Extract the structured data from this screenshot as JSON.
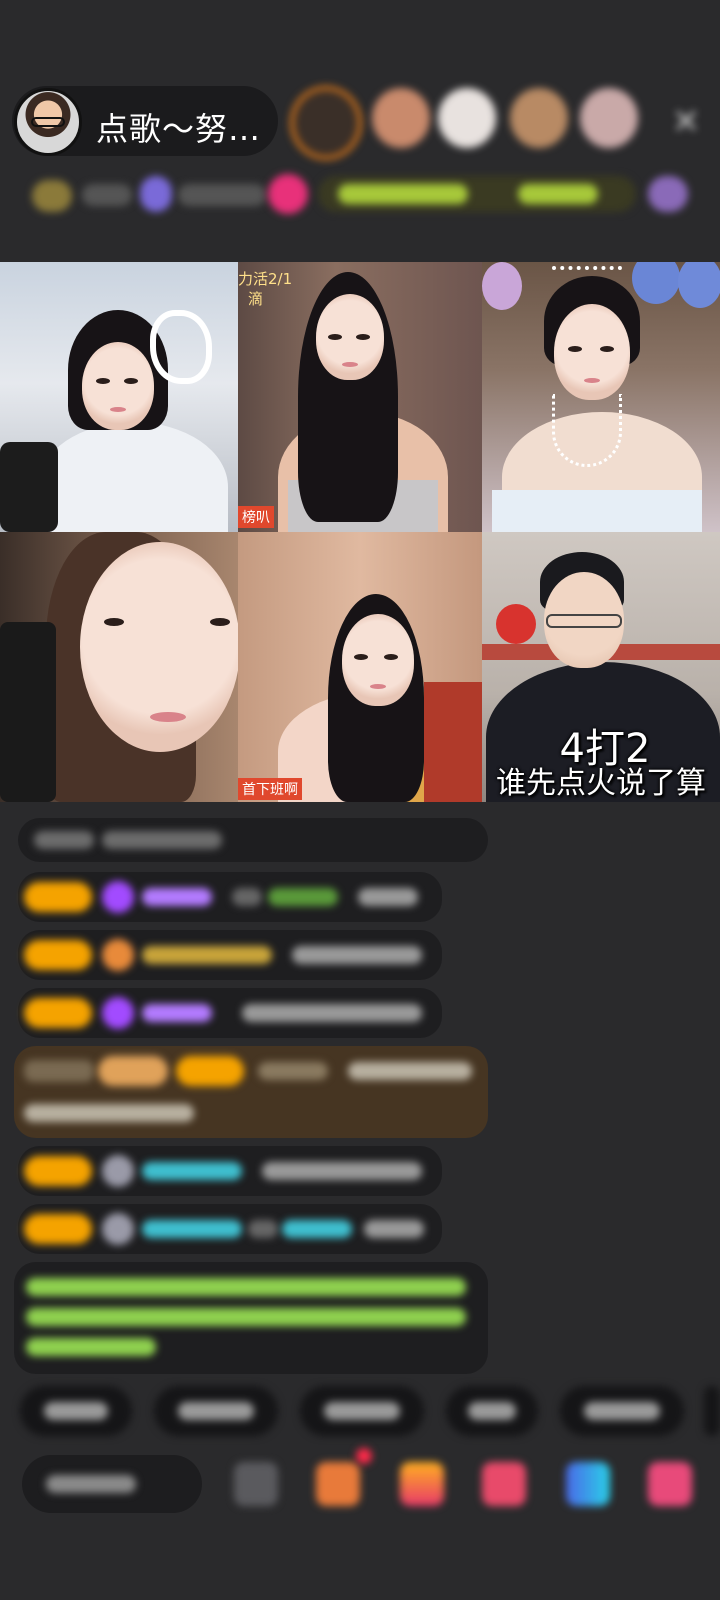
{
  "header": {
    "host_title": "点歌～努…",
    "close_icon": "close-icon",
    "viewer_colors": [
      "#e07a1a",
      "#c98a6c",
      "#e8e2df",
      "#b88a64",
      "#c9a9a8"
    ]
  },
  "video_grid": {
    "cells": [
      {
        "id": "guest-1",
        "tag": ""
      },
      {
        "id": "guest-2",
        "tag_top": "力活2/1",
        "tag_top2": "滴",
        "tag_bottom": "榜叭"
      },
      {
        "id": "guest-3",
        "tag": ""
      },
      {
        "id": "guest-4",
        "tag": ""
      },
      {
        "id": "guest-5",
        "tag_bottom": "首下班啊"
      },
      {
        "id": "guest-6",
        "caption_line1": "4打2",
        "caption_line2": "谁先点火说了算"
      }
    ]
  },
  "colors": {
    "background": "#2a2a2c",
    "badge": "#f5a300",
    "accent_red": "#e0482d",
    "username_purple": "#b37bff",
    "username_teal": "#3fbfcf",
    "system_green": "#8fd14f"
  }
}
